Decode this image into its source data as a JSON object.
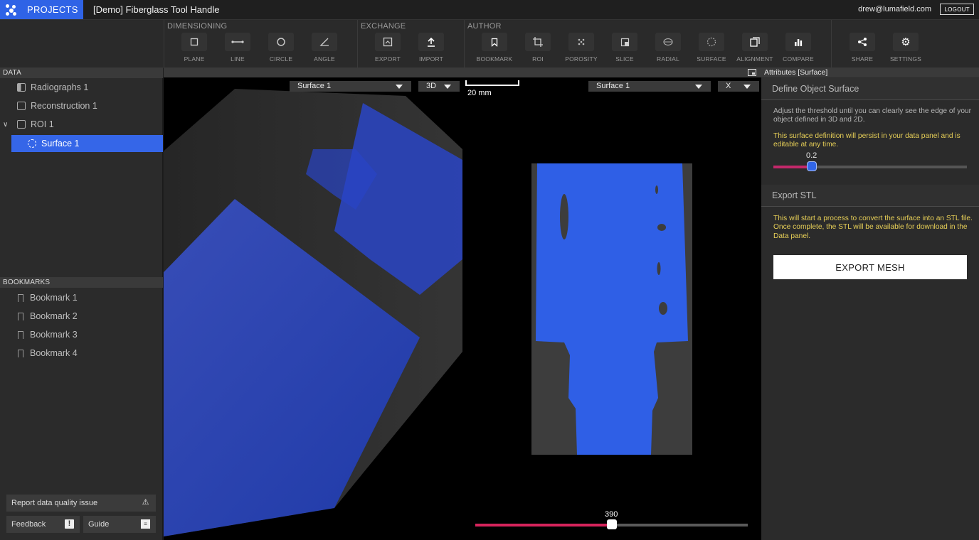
{
  "app": {
    "projects_label": "PROJECTS",
    "title": "[Demo] Fiberglass Tool Handle",
    "user_email": "drew@lumafield.com",
    "logout_label": "LOGOUT"
  },
  "toolbar": {
    "groups": [
      {
        "label": "DIMENSIONING",
        "buttons": [
          {
            "label": "PLANE",
            "icon": "square-icon"
          },
          {
            "label": "LINE",
            "icon": "line-icon"
          },
          {
            "label": "CIRCLE",
            "icon": "circle-icon"
          },
          {
            "label": "ANGLE",
            "icon": "angle-icon"
          }
        ]
      },
      {
        "label": "EXCHANGE",
        "buttons": [
          {
            "label": "EXPORT",
            "icon": "export-icon"
          },
          {
            "label": "IMPORT",
            "icon": "upload-icon"
          }
        ]
      },
      {
        "label": "AUTHOR",
        "buttons": [
          {
            "label": "BOOKMARK",
            "icon": "bookmark-icon"
          },
          {
            "label": "ROI",
            "icon": "crop-icon"
          },
          {
            "label": "POROSITY",
            "icon": "porosity-icon"
          },
          {
            "label": "SLICE",
            "icon": "slice-icon"
          },
          {
            "label": "RADIAL",
            "icon": "radial-icon"
          },
          {
            "label": "SURFACE",
            "icon": "surface-icon"
          },
          {
            "label": "ALIGNMENT",
            "icon": "alignment-icon"
          },
          {
            "label": "COMPARE",
            "icon": "bar-chart-icon"
          }
        ]
      },
      {
        "label": "",
        "buttons": [
          {
            "label": "SHARE",
            "icon": "share-icon"
          },
          {
            "label": "SETTINGS",
            "icon": "gear-icon"
          }
        ]
      }
    ]
  },
  "data_panel": {
    "header": "DATA",
    "items": [
      {
        "label": "Radiographs 1"
      },
      {
        "label": "Reconstruction 1"
      },
      {
        "label": "ROI 1"
      },
      {
        "label": "Surface 1"
      }
    ],
    "selected": "Surface 1"
  },
  "bookmarks_panel": {
    "header": "BOOKMARKS",
    "items": [
      "Bookmark 1",
      "Bookmark 2",
      "Bookmark 3",
      "Bookmark 4"
    ]
  },
  "left_footer": {
    "report_label": "Report data quality issue",
    "feedback_label": "Feedback",
    "guide_label": "Guide"
  },
  "viewport": {
    "left_dropdown": "Surface 1",
    "left_mode": "3D",
    "right_dropdown": "Surface 1",
    "right_axis": "X",
    "scale_label": "20 mm",
    "slice_value": "390",
    "slice_fraction": 0.5,
    "surface_color": "#2f5fe6",
    "slider_color": "#d6245c"
  },
  "attributes": {
    "header": "Attributes [Surface]",
    "define_title": "Define Object Surface",
    "define_text": "Adjust the threshold until you can clearly see the edge of your object defined in 3D and 2D.",
    "define_note": "This surface definition will persist in your data panel and is editable at any time.",
    "threshold_value": "0.2",
    "threshold_fraction": 0.2,
    "export_title": "Export STL",
    "export_note": "This will start a process to convert the surface into an STL file. Once complete, the STL will be available for download in the Data panel.",
    "export_button": "EXPORT MESH"
  }
}
